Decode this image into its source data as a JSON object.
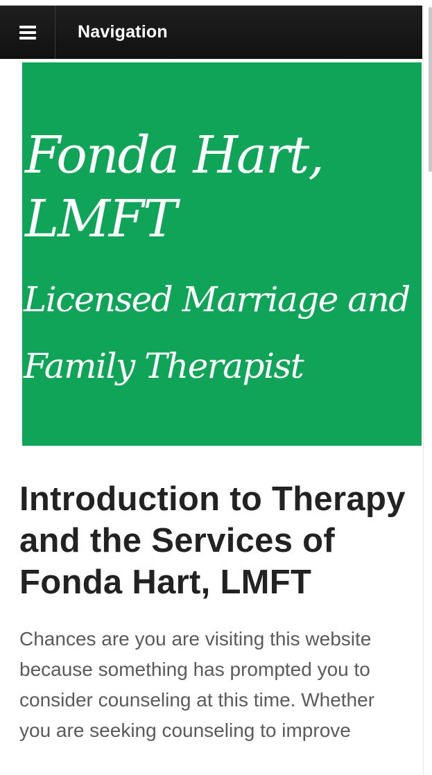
{
  "navbar": {
    "menu_icon": "hamburger-menu-icon",
    "title": "Navigation"
  },
  "banner": {
    "background_color": "#10a458",
    "name": "Fonda Hart, LMFT",
    "subtitle": "Licensed Marriage and Family Therapist"
  },
  "article": {
    "heading": "Introduction to Therapy and the Services of Fonda Hart, LMFT",
    "intro": "Chances are you are visiting this website because something has prompted you to consider counseling at this time. Whether you are seeking counseling to improve"
  }
}
